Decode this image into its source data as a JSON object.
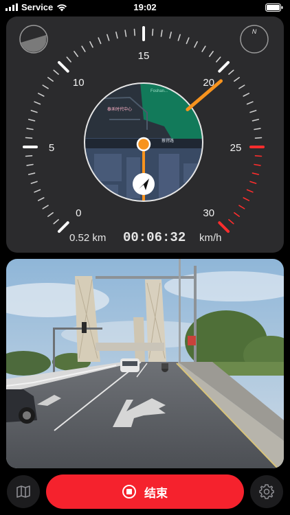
{
  "status_bar": {
    "carrier": "Service",
    "time": "19:02"
  },
  "speedometer": {
    "ticks": [
      "0",
      "5",
      "10",
      "15",
      "20",
      "25",
      "30"
    ],
    "current_speed": 20.5,
    "distance": "0.52 km",
    "duration": "00:06:32",
    "unit": "km/h",
    "compass_label": "N",
    "accent_color": "#f7931e",
    "warning_color": "#ff2d2d"
  },
  "minimap": {
    "labels": [
      "蔡锷路",
      "泰禾时代中心"
    ],
    "poi_label": "Foshan..."
  },
  "bottom_bar": {
    "stop_label": "结束",
    "map_icon": "map-icon",
    "settings_icon": "gear-icon"
  }
}
